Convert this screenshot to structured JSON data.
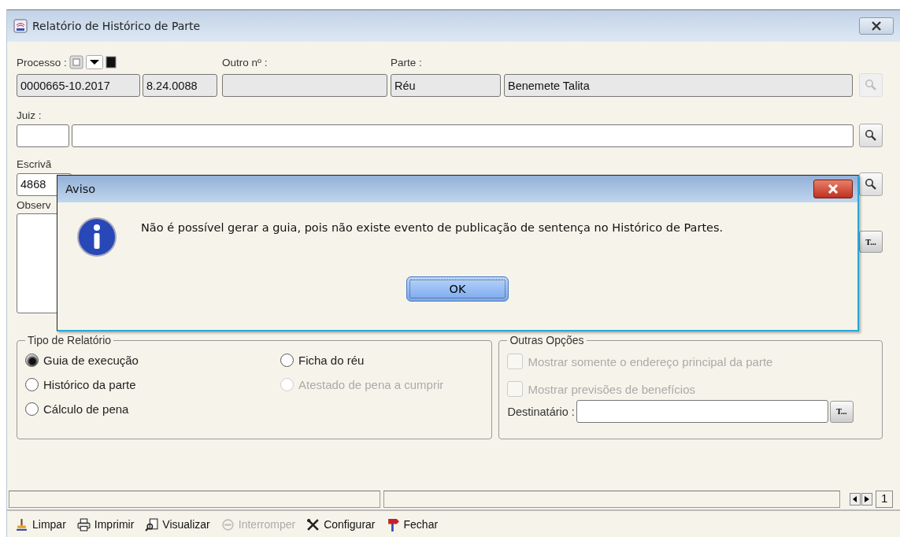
{
  "window": {
    "title": "Relatório de Histórico de Parte"
  },
  "processo": {
    "label": "Processo :",
    "number": "0000665-10.2017",
    "suffix": "8.24.0088"
  },
  "outro": {
    "label": "Outro nº :"
  },
  "parte": {
    "label": "Parte :",
    "tipo": "Réu",
    "nome": "Benemete Talita"
  },
  "juiz": {
    "label": "Juiz :"
  },
  "escrivao": {
    "label": "Escrivã",
    "value": "4868"
  },
  "observacoes": {
    "label": "Observ",
    "button": "T..."
  },
  "tipo_relatorio": {
    "legend": "Tipo de Relatório",
    "options": [
      {
        "label": "Guia de execução",
        "selected": true,
        "disabled": false
      },
      {
        "label": "Ficha do réu",
        "selected": false,
        "disabled": false
      },
      {
        "label": "Histórico da parte",
        "selected": false,
        "disabled": false
      },
      {
        "label": "Atestado de pena a cumprir",
        "selected": false,
        "disabled": true
      },
      {
        "label": "Cálculo de pena",
        "selected": false,
        "disabled": false
      }
    ]
  },
  "outras_opcoes": {
    "legend": "Outras Opções",
    "options": [
      {
        "label": "Mostrar somente o endereço principal da parte",
        "checked": false,
        "disabled": true
      },
      {
        "label": "Mostrar previsões de benefícios",
        "checked": false,
        "disabled": true
      }
    ],
    "destinatario": {
      "label": "Destinatário :",
      "button": "T..."
    }
  },
  "status_bar": {
    "page": "1"
  },
  "toolbar": [
    {
      "kind": "broom",
      "label": "Limpar",
      "disabled": false
    },
    {
      "kind": "printer",
      "label": "Imprimir",
      "disabled": false
    },
    {
      "kind": "preview",
      "label": "Visualizar",
      "disabled": false
    },
    {
      "kind": "stop",
      "label": "Interromper",
      "disabled": true
    },
    {
      "kind": "tools",
      "label": "Configurar",
      "disabled": false
    },
    {
      "kind": "sign",
      "label": "Fechar",
      "disabled": false
    }
  ],
  "dialog": {
    "title": "Aviso",
    "message": "Não é possível gerar a guia, pois não existe evento de publicação de sentença no Histórico de Partes.",
    "ok": "OK"
  }
}
